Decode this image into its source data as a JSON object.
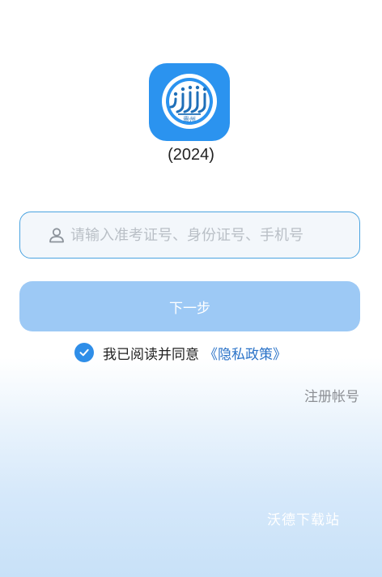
{
  "app": {
    "logo_text": "贵州",
    "version": "(2024)"
  },
  "login": {
    "input_placeholder": "请输入准考证号、身份证号、手机号",
    "next_label": "下一步",
    "agree_text": "我已阅读并同意",
    "policy_link": "《隐私政策》",
    "agree_checked": true,
    "register_label": "注册帐号"
  },
  "watermark": "沃德下载站",
  "colors": {
    "brand": "#2b93ef",
    "button": "#9dc9f5",
    "link": "#2b73c8"
  }
}
